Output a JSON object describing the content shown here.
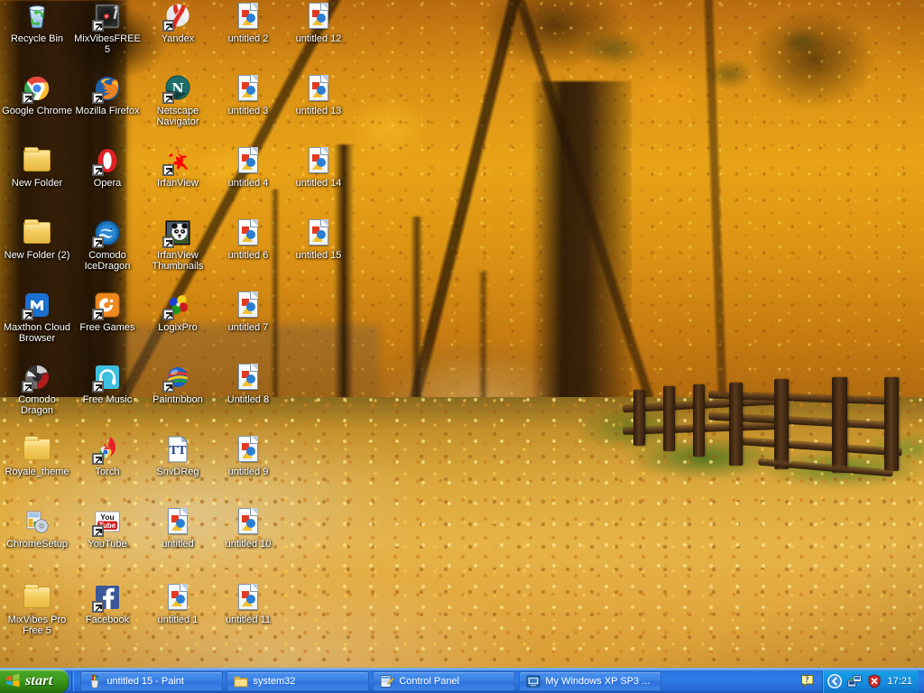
{
  "desktop": {
    "wallpaper_description": "Autumn forest lane with golden leaves and wooden fence",
    "icons": [
      {
        "label": "Recycle Bin",
        "icon": "recycle-bin-icon",
        "shortcut": false,
        "col": 0,
        "row": 0
      },
      {
        "label": "MixVibesFREE5",
        "icon": "mixvibes-turntable-icon",
        "shortcut": true,
        "col": 1,
        "row": 0
      },
      {
        "label": "Yandex",
        "icon": "yandex-browser-icon",
        "shortcut": true,
        "col": 2,
        "row": 0
      },
      {
        "label": "untitled 2",
        "icon": "image-file-icon",
        "shortcut": false,
        "col": 3,
        "row": 0
      },
      {
        "label": "untitled 12",
        "icon": "image-file-icon",
        "shortcut": false,
        "col": 4,
        "row": 0
      },
      {
        "label": "Google Chrome",
        "icon": "google-chrome-icon",
        "shortcut": true,
        "col": 0,
        "row": 1
      },
      {
        "label": "Mozilla Firefox",
        "icon": "mozilla-firefox-icon",
        "shortcut": true,
        "col": 1,
        "row": 1
      },
      {
        "label": "Netscape Navigator",
        "icon": "netscape-navigator-icon",
        "shortcut": true,
        "col": 2,
        "row": 1
      },
      {
        "label": "untitled 3",
        "icon": "image-file-icon",
        "shortcut": false,
        "col": 3,
        "row": 1
      },
      {
        "label": "untitled 13",
        "icon": "image-file-icon",
        "shortcut": false,
        "col": 4,
        "row": 1
      },
      {
        "label": "New Folder",
        "icon": "folder-icon",
        "shortcut": false,
        "col": 0,
        "row": 2
      },
      {
        "label": "Opera",
        "icon": "opera-browser-icon",
        "shortcut": true,
        "col": 1,
        "row": 2
      },
      {
        "label": "IrfanView",
        "icon": "irfanview-icon",
        "shortcut": true,
        "col": 2,
        "row": 2
      },
      {
        "label": "untitled 4",
        "icon": "image-file-icon",
        "shortcut": false,
        "col": 3,
        "row": 2
      },
      {
        "label": "untitled 14",
        "icon": "image-file-icon",
        "shortcut": false,
        "col": 4,
        "row": 2
      },
      {
        "label": "New Folder (2)",
        "icon": "folder-icon",
        "shortcut": false,
        "col": 0,
        "row": 3
      },
      {
        "label": "Comodo IceDragon",
        "icon": "comodo-icedragon-icon",
        "shortcut": true,
        "col": 1,
        "row": 3
      },
      {
        "label": "IrfanView Thumbnails",
        "icon": "irfanview-thumbnails-icon",
        "shortcut": true,
        "col": 2,
        "row": 3
      },
      {
        "label": "untitled 6",
        "icon": "image-file-icon",
        "shortcut": false,
        "col": 3,
        "row": 3
      },
      {
        "label": "untitled 15",
        "icon": "image-file-icon",
        "shortcut": false,
        "col": 4,
        "row": 3
      },
      {
        "label": "Maxthon Cloud Browser",
        "icon": "maxthon-browser-icon",
        "shortcut": true,
        "col": 0,
        "row": 4
      },
      {
        "label": "Free Games",
        "icon": "free-games-icon",
        "shortcut": true,
        "col": 1,
        "row": 4
      },
      {
        "label": "LogixPro",
        "icon": "logixpro-icon",
        "shortcut": true,
        "col": 2,
        "row": 4
      },
      {
        "label": "untitled 7",
        "icon": "image-file-icon",
        "shortcut": false,
        "col": 3,
        "row": 4
      },
      {
        "label": "Comodo Dragon",
        "icon": "comodo-dragon-icon",
        "shortcut": true,
        "col": 0,
        "row": 5
      },
      {
        "label": "Free Music",
        "icon": "free-music-icon",
        "shortcut": true,
        "col": 1,
        "row": 5
      },
      {
        "label": "Paintribbon",
        "icon": "paintribbon-icon",
        "shortcut": true,
        "col": 2,
        "row": 5
      },
      {
        "label": "Untitled 8",
        "icon": "image-file-icon",
        "shortcut": false,
        "col": 3,
        "row": 5
      },
      {
        "label": "Royale_theme",
        "icon": "folder-icon",
        "shortcut": false,
        "col": 0,
        "row": 6
      },
      {
        "label": "Torch",
        "icon": "torch-browser-icon",
        "shortcut": true,
        "col": 1,
        "row": 6
      },
      {
        "label": "SnvDReg",
        "icon": "truetype-font-icon",
        "shortcut": false,
        "col": 2,
        "row": 6
      },
      {
        "label": "untitled 9",
        "icon": "image-file-icon",
        "shortcut": false,
        "col": 3,
        "row": 6
      },
      {
        "label": "ChromeSetup",
        "icon": "installer-setup-icon",
        "shortcut": false,
        "col": 0,
        "row": 7
      },
      {
        "label": "YouTube",
        "icon": "youtube-icon",
        "shortcut": true,
        "col": 1,
        "row": 7
      },
      {
        "label": "untitled",
        "icon": "image-file-icon",
        "shortcut": false,
        "col": 2,
        "row": 7
      },
      {
        "label": "untitled 10",
        "icon": "image-file-icon",
        "shortcut": false,
        "col": 3,
        "row": 7
      },
      {
        "label": "MixVibes Pro Free 5",
        "icon": "folder-icon",
        "shortcut": false,
        "col": 0,
        "row": 8
      },
      {
        "label": "Facebook",
        "icon": "facebook-icon",
        "shortcut": true,
        "col": 1,
        "row": 8
      },
      {
        "label": "untitled 1",
        "icon": "image-file-icon",
        "shortcut": false,
        "col": 2,
        "row": 8
      },
      {
        "label": "untitled 11",
        "icon": "image-file-icon",
        "shortcut": false,
        "col": 3,
        "row": 8
      }
    ]
  },
  "taskbar": {
    "start_label": "start",
    "start_icon": "windows-flag-icon",
    "buttons": [
      {
        "label": "untitled 15 - Paint",
        "icon": "paint-icon"
      },
      {
        "label": "system32",
        "icon": "folder-icon"
      },
      {
        "label": "Control Panel",
        "icon": "control-panel-icon"
      },
      {
        "label": "My Windows XP SP3 ...",
        "icon": "computer-window-icon"
      }
    ],
    "notification": {
      "icon": "help-balloon-icon"
    },
    "tray": [
      {
        "icon": "show-hidden-icons-chevron-icon"
      },
      {
        "icon": "network-connection-icon"
      },
      {
        "icon": "security-shield-icon"
      }
    ],
    "clock": "17:21"
  },
  "colors": {
    "taskbar_blue": "#2f7ce8",
    "start_green": "#3d9a1c",
    "tray_blue": "#1489dd",
    "icon_label_text": "#ffffff"
  }
}
